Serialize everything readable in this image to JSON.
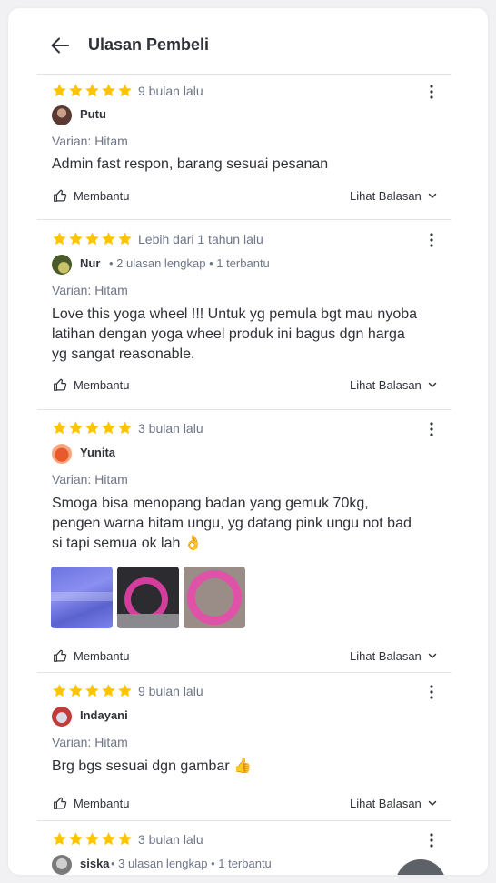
{
  "header": {
    "title": "Ulasan Pembeli"
  },
  "reviews": [
    {
      "rating": 5,
      "time": "9 bulan lalu",
      "name": "Putu",
      "meta": "",
      "variant": "Varian: Hitam",
      "text": "Admin fast respon, barang sesuai pesanan",
      "helpful_label": "Membantu",
      "replies_label": "Lihat Balasan"
    },
    {
      "rating": 5,
      "time": "Lebih dari 1 tahun lalu",
      "name": "Nur",
      "meta": "• 2 ulasan lengkap • 1 terbantu",
      "variant": "Varian: Hitam",
      "text_lines": [
        "Love this yoga wheel !!! Untuk yg pemula bgt mau nyoba",
        "latihan dengan yoga wheel produk ini bagus dgn harga",
        "yg sangat reasonable."
      ],
      "helpful_label": "Membantu",
      "replies_label": "Lihat Balasan"
    },
    {
      "rating": 5,
      "time": "3 bulan lalu",
      "name": "Yunita",
      "meta": "",
      "variant": "Varian: Hitam",
      "text_lines": [
        "Smoga bisa menopang badan yang gemuk 70kg,",
        "pengen warna hitam ungu, yg datang pink ungu not bad",
        "si tapi semua ok lah 👌"
      ],
      "photos": [
        "purple-mat-photo",
        "pink-wheel-photo",
        "pink-wheel-closeup-photo"
      ],
      "helpful_label": "Membantu",
      "replies_label": "Lihat Balasan"
    },
    {
      "rating": 5,
      "time": "9 bulan lalu",
      "name": "Indayani",
      "meta": "",
      "variant": "Varian: Hitam",
      "text": "Brg bgs sesuai dgn gambar 👍",
      "helpful_label": "Membantu",
      "replies_label": "Lihat Balasan"
    },
    {
      "rating": 5,
      "time": "3 bulan lalu",
      "name": "siska",
      "meta": "• 3 ulasan lengkap • 1 terbantu"
    }
  ],
  "colors": {
    "star": "#ffc400",
    "divider": "#e2e4e8",
    "text": "#2e3137",
    "muted": "#6d7588"
  },
  "icons": [
    "back-arrow-icon",
    "star-icon",
    "kebab-menu-icon",
    "thumbs-up-icon",
    "chevron-down-icon"
  ]
}
